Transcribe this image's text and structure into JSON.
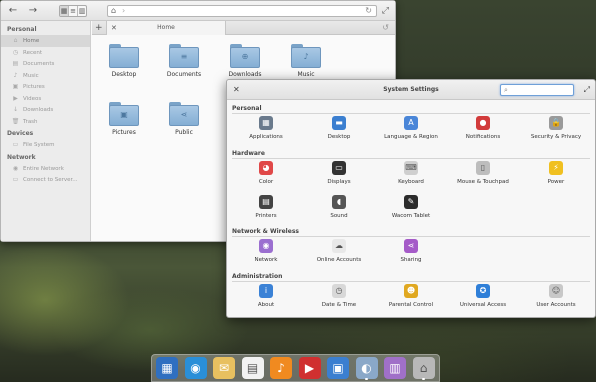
{
  "file_manager": {
    "toolbar": {
      "back_icon": "back-arrow-icon",
      "forward_icon": "forward-arrow-icon",
      "view_modes": [
        "icon-view",
        "list-view",
        "column-view"
      ],
      "active_view": "icon-view"
    },
    "location_bar": {
      "home_icon": "home-icon"
    },
    "tab_label": "Home",
    "sidebar": {
      "sections": [
        {
          "title": "Personal",
          "items": [
            {
              "label": "Home",
              "icon": "home-icon",
              "selected": true
            },
            {
              "label": "Recent",
              "icon": "clock-icon"
            },
            {
              "label": "Documents",
              "icon": "document-icon"
            },
            {
              "label": "Music",
              "icon": "music-icon"
            },
            {
              "label": "Pictures",
              "icon": "picture-icon"
            },
            {
              "label": "Videos",
              "icon": "video-icon"
            },
            {
              "label": "Downloads",
              "icon": "download-icon"
            },
            {
              "label": "Trash",
              "icon": "trash-icon"
            }
          ]
        },
        {
          "title": "Devices",
          "items": [
            {
              "label": "File System",
              "icon": "drive-icon"
            }
          ]
        },
        {
          "title": "Network",
          "items": [
            {
              "label": "Entire Network",
              "icon": "network-icon"
            },
            {
              "label": "Connect to Server...",
              "icon": "server-icon"
            }
          ]
        }
      ]
    },
    "files": [
      {
        "label": "Desktop",
        "emblem": ""
      },
      {
        "label": "Documents",
        "emblem": "≡"
      },
      {
        "label": "Downloads",
        "emblem": "⊕"
      },
      {
        "label": "Music",
        "emblem": "♪"
      },
      {
        "label": "Pictures",
        "emblem": "▣"
      },
      {
        "label": "Public",
        "emblem": "⋖"
      }
    ]
  },
  "system_settings": {
    "title": "System Settings",
    "search": {
      "placeholder": "",
      "value": ""
    },
    "categories": [
      {
        "title": "Personal",
        "items": [
          {
            "label": "Applications",
            "icon": "applications-icon",
            "color": "#6a7a8c",
            "glyph": "▦"
          },
          {
            "label": "Desktop",
            "icon": "desktop-icon",
            "color": "#3b7fd0",
            "glyph": "▬"
          },
          {
            "label": "Language & Region",
            "icon": "language-icon",
            "color": "#4a86d8",
            "glyph": "A"
          },
          {
            "label": "Notifications",
            "icon": "notifications-icon",
            "color": "#d23b3b",
            "glyph": "●"
          },
          {
            "label": "Security & Privacy",
            "icon": "lock-icon",
            "color": "#9a9a9a",
            "glyph": "🔒"
          }
        ]
      },
      {
        "title": "Hardware",
        "items": [
          {
            "label": "Color",
            "icon": "color-icon",
            "color": "#e04848",
            "glyph": "◕"
          },
          {
            "label": "Displays",
            "icon": "displays-icon",
            "color": "#333333",
            "glyph": "▭"
          },
          {
            "label": "Keyboard",
            "icon": "keyboard-icon",
            "color": "#cfcfcf",
            "glyph": "⌨"
          },
          {
            "label": "Mouse & Touchpad",
            "icon": "mouse-icon",
            "color": "#bdbdbd",
            "glyph": "▯"
          },
          {
            "label": "Power",
            "icon": "power-icon",
            "color": "#f0c020",
            "glyph": "⚡"
          },
          {
            "label": "Printers",
            "icon": "printer-icon",
            "color": "#444444",
            "glyph": "▤"
          },
          {
            "label": "Sound",
            "icon": "sound-icon",
            "color": "#555555",
            "glyph": "◖"
          },
          {
            "label": "Wacom Tablet",
            "icon": "tablet-icon",
            "color": "#2c2c2c",
            "glyph": "✎"
          }
        ]
      },
      {
        "title": "Network & Wireless",
        "items": [
          {
            "label": "Network",
            "icon": "network-icon",
            "color": "#9b6fd0",
            "glyph": "◉"
          },
          {
            "label": "Online Accounts",
            "icon": "cloud-icon",
            "color": "#e8e8e8",
            "glyph": "☁"
          },
          {
            "label": "Sharing",
            "icon": "sharing-icon",
            "color": "#a55bc8",
            "glyph": "⋖"
          }
        ]
      },
      {
        "title": "Administration",
        "items": [
          {
            "label": "About",
            "icon": "about-icon",
            "color": "#3b82d6",
            "glyph": "i"
          },
          {
            "label": "Date & Time",
            "icon": "clock-icon",
            "color": "#d8d8d8",
            "glyph": "◷"
          },
          {
            "label": "Parental Control",
            "icon": "parental-icon",
            "color": "#e0a820",
            "glyph": "☻"
          },
          {
            "label": "Universal Access",
            "icon": "accessibility-icon",
            "color": "#2f7fd8",
            "glyph": "✪"
          },
          {
            "label": "User Accounts",
            "icon": "users-icon",
            "color": "#c8c8c8",
            "glyph": "☺"
          }
        ]
      }
    ]
  },
  "dock": {
    "items": [
      {
        "name": "multitasking-view-icon",
        "color": "#2f6fc0",
        "glyph": "▦",
        "running": false
      },
      {
        "name": "web-browser-icon",
        "color": "#2a8fd8",
        "glyph": "◉",
        "running": false
      },
      {
        "name": "mail-icon",
        "color": "#e8c060",
        "glyph": "✉",
        "running": false
      },
      {
        "name": "calendar-icon",
        "color": "#f2f2f2",
        "glyph": "▤",
        "running": false
      },
      {
        "name": "music-player-icon",
        "color": "#f08a20",
        "glyph": "♪",
        "running": false
      },
      {
        "name": "videos-icon",
        "color": "#d03030",
        "glyph": "▶",
        "running": false
      },
      {
        "name": "photos-icon",
        "color": "#3b7fd0",
        "glyph": "▣",
        "running": false
      },
      {
        "name": "settings-switch-icon",
        "color": "#8aa8c8",
        "glyph": "◐",
        "running": true
      },
      {
        "name": "app-center-icon",
        "color": "#a070c8",
        "glyph": "▥",
        "running": false
      },
      {
        "name": "files-icon",
        "color": "#b8b8b8",
        "glyph": "⌂",
        "running": true
      }
    ]
  }
}
